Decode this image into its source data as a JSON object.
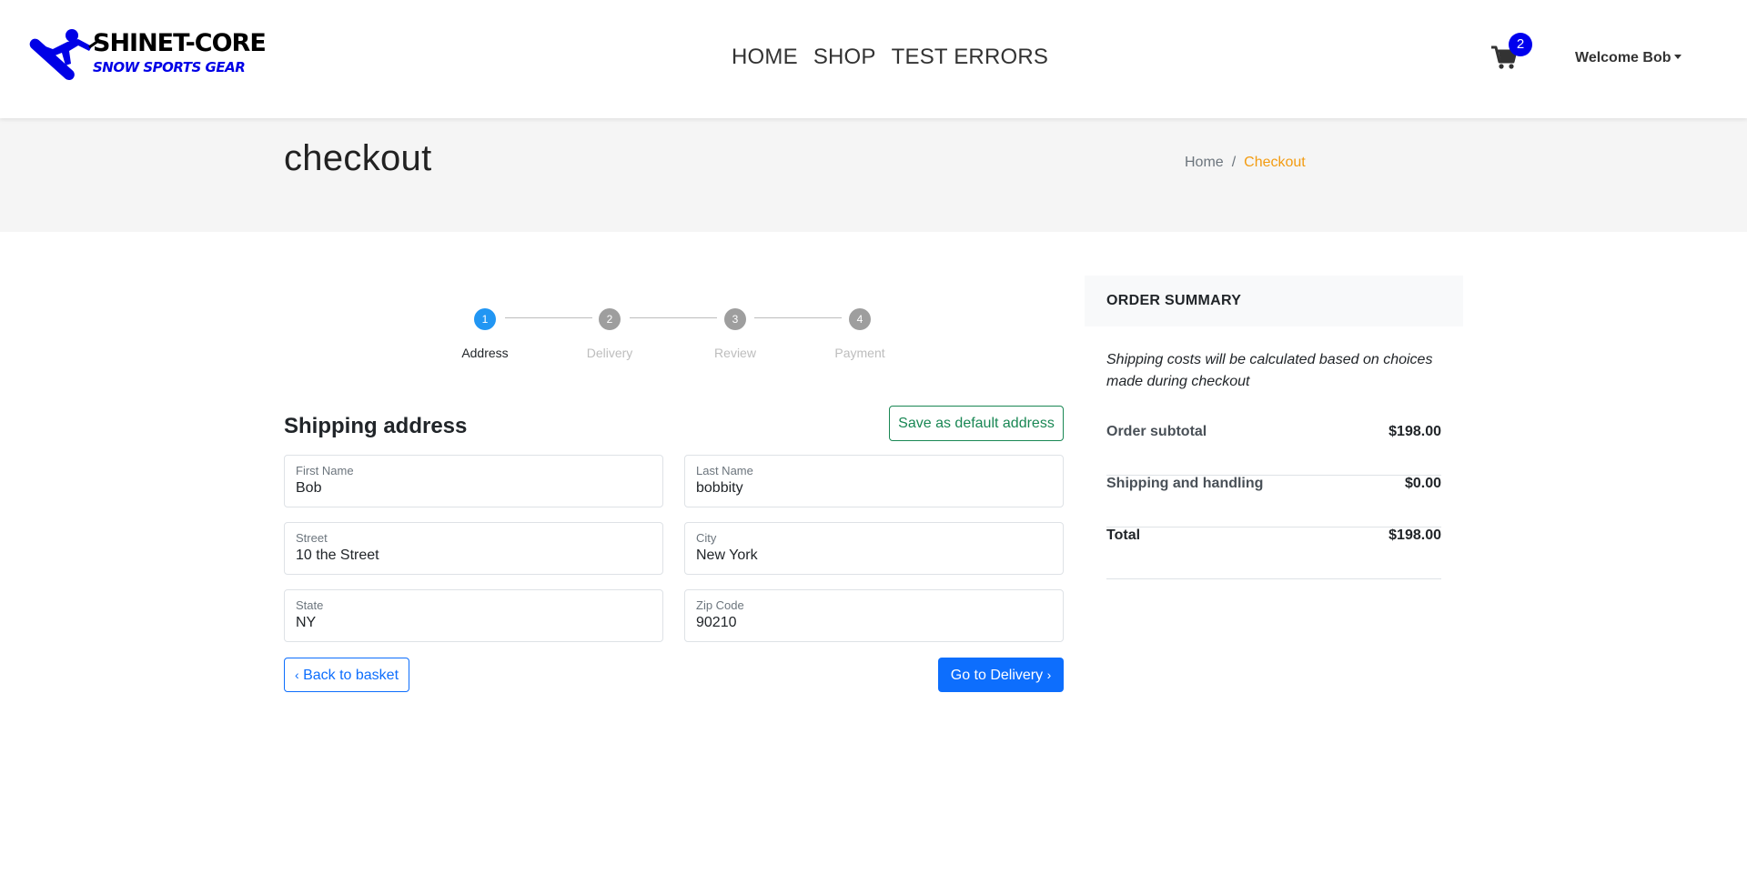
{
  "header": {
    "logo": {
      "title": "SHINET-CORE",
      "subtitle": "SNOW SPORTS GEAR"
    },
    "nav": [
      {
        "label": "HOME"
      },
      {
        "label": "SHOP"
      },
      {
        "label": "TEST ERRORS"
      }
    ],
    "cart": {
      "icon": "shopping-cart-icon",
      "count": "2"
    },
    "user_menu": {
      "label": "Welcome Bob"
    }
  },
  "page": {
    "title": "checkout",
    "breadcrumb": {
      "home": "Home",
      "separator": "/",
      "current": "Checkout"
    }
  },
  "stepper": {
    "steps": [
      {
        "number": "1",
        "label": "Address",
        "active": true
      },
      {
        "number": "2",
        "label": "Delivery",
        "active": false
      },
      {
        "number": "3",
        "label": "Review",
        "active": false
      },
      {
        "number": "4",
        "label": "Payment",
        "active": false
      }
    ]
  },
  "shipping": {
    "title": "Shipping address",
    "save_default_label": "Save as default address",
    "fields": {
      "first_name": {
        "label": "First Name",
        "value": "Bob"
      },
      "last_name": {
        "label": "Last Name",
        "value": "bobbity"
      },
      "street": {
        "label": "Street",
        "value": "10 the Street"
      },
      "city": {
        "label": "City",
        "value": "New York"
      },
      "state": {
        "label": "State",
        "value": "NY"
      },
      "zip": {
        "label": "Zip Code",
        "value": "90210"
      }
    },
    "back_label": "Back to basket",
    "next_label": "Go to Delivery"
  },
  "summary": {
    "title": "ORDER SUMMARY",
    "note": "Shipping costs will be calculated based on choices made during checkout",
    "rows": [
      {
        "label": "Order subtotal",
        "amount": "$198.00"
      },
      {
        "label": "Shipping and handling",
        "amount": "$0.00"
      },
      {
        "label": "Total",
        "amount": "$198.00"
      }
    ]
  },
  "colors": {
    "primary": "#0d6efd",
    "success": "#198754",
    "step_active": "#2196f3",
    "breadcrumb_active": "#f39c12",
    "logo_blue": "#0000e6"
  }
}
